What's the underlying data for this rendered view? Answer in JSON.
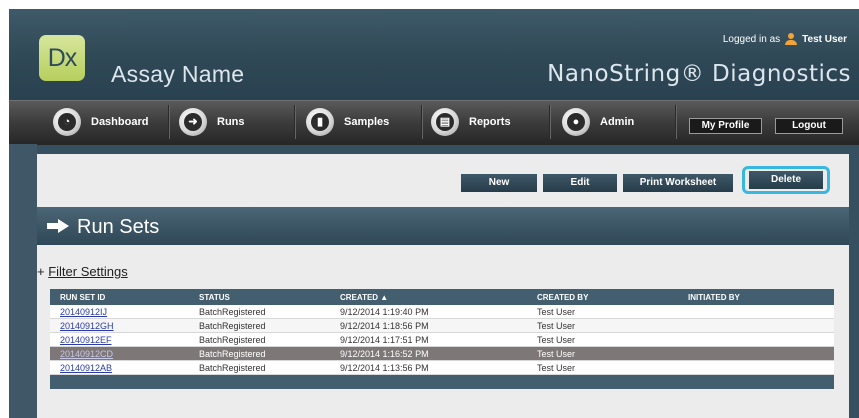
{
  "header": {
    "logo_text": "Dx",
    "assay_name": "Assay Name",
    "brand": "NanoString® Diagnostics",
    "login_prefix": "Logged in as",
    "user_name": "Test User"
  },
  "nav": {
    "items": [
      {
        "label": "Dashboard",
        "icon": "dashboard-icon"
      },
      {
        "label": "Runs",
        "icon": "arrow-right-icon"
      },
      {
        "label": "Samples",
        "icon": "sample-tube-icon"
      },
      {
        "label": "Reports",
        "icon": "report-icon"
      },
      {
        "label": "Admin",
        "icon": "admin-user-icon"
      }
    ],
    "my_profile": "My Profile",
    "logout": "Logout"
  },
  "actions": {
    "new": "New",
    "edit": "Edit",
    "print_worksheet": "Print Worksheet",
    "delete": "Delete"
  },
  "section": {
    "title": "Run Sets",
    "filter_prefix": "+",
    "filter_label": "Filter Settings"
  },
  "table": {
    "columns": [
      "RUN SET ID",
      "STATUS",
      "CREATED ▲",
      "CREATED BY",
      "INITIATED BY"
    ],
    "rows": [
      {
        "id": "20140912IJ",
        "status": "BatchRegistered",
        "created": "9/12/2014 1:19:40 PM",
        "created_by": "Test User",
        "initiated_by": ""
      },
      {
        "id": "20140912GH",
        "status": "BatchRegistered",
        "created": "9/12/2014 1:18:56 PM",
        "created_by": "Test User",
        "initiated_by": ""
      },
      {
        "id": "20140912EF",
        "status": "BatchRegistered",
        "created": "9/12/2014 1:17:51 PM",
        "created_by": "Test User",
        "initiated_by": ""
      },
      {
        "id": "20140912CD",
        "status": "BatchRegistered",
        "created": "9/12/2014 1:16:52 PM",
        "created_by": "Test User",
        "initiated_by": "",
        "selected": true
      },
      {
        "id": "20140912AB",
        "status": "BatchRegistered",
        "created": "9/12/2014 1:13:56 PM",
        "created_by": "Test User",
        "initiated_by": ""
      }
    ]
  },
  "colors": {
    "header_bg": "#2f4856",
    "nav_bg": "#3b3b3b",
    "accent_highlight": "#38b8e0",
    "logo_green": "#b6cf5c",
    "selected_row": "#7e7778"
  }
}
